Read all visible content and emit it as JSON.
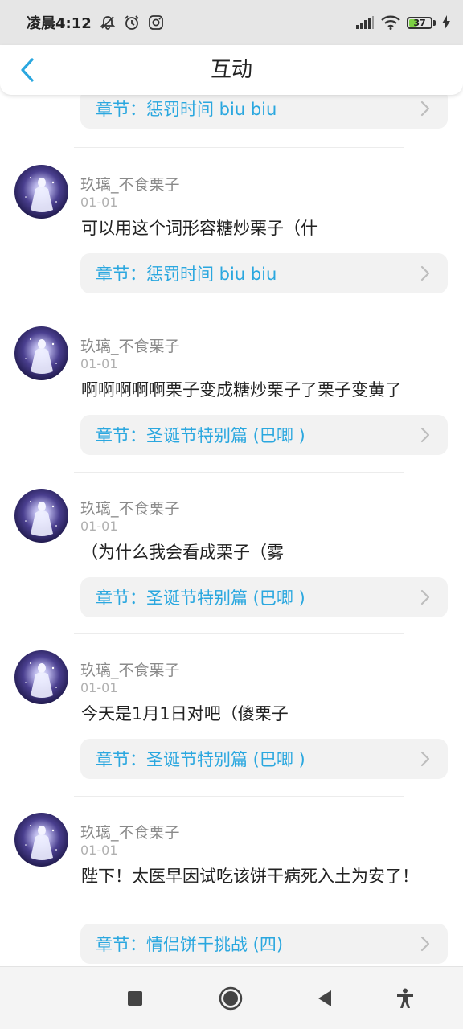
{
  "status_bar": {
    "time": "凌晨4:12",
    "battery_level": "37",
    "battery_fraction": 0.37,
    "icons": [
      "mute-icon",
      "alarm-icon",
      "instagram-icon",
      "signal-icon",
      "wifi-icon",
      "battery-icon",
      "charging-icon"
    ]
  },
  "header": {
    "title": "互动",
    "back_icon": "chevron-left-icon"
  },
  "colors": {
    "accent": "#2aa7df",
    "card_bg": "#f2f2f2",
    "username": "#8a8a8a",
    "date": "#b0b0b0"
  },
  "top_partial": {
    "chapter": "章节：惩罚时间 biu biu"
  },
  "comments": [
    {
      "username": "玖璃_不食栗子",
      "date": "01-01",
      "text": "可以用这个词形容糖炒栗子（什",
      "chapter": "章节：惩罚时间 biu biu"
    },
    {
      "username": "玖璃_不食栗子",
      "date": "01-01",
      "text": "啊啊啊啊啊栗子变成糖炒栗子了栗子变黄了",
      "chapter": "章节：圣诞节特别篇 (巴唧 )"
    },
    {
      "username": "玖璃_不食栗子",
      "date": "01-01",
      "text": "（为什么我会看成栗子（雾",
      "chapter": "章节：圣诞节特别篇 (巴唧 )"
    },
    {
      "username": "玖璃_不食栗子",
      "date": "01-01",
      "text": "今天是1月1日对吧（傻栗子",
      "chapter": "章节：圣诞节特别篇 (巴唧 )"
    },
    {
      "username": "玖璃_不食栗子",
      "date": "01-01",
      "text": "陛下！太医早因试吃该饼干病死入土为安了！",
      "chapter": "章节：情侣饼干挑战 (四)"
    }
  ],
  "nav_bar": {
    "icons": [
      "recent-apps-icon",
      "home-icon",
      "back-icon",
      "accessibility-icon"
    ]
  }
}
